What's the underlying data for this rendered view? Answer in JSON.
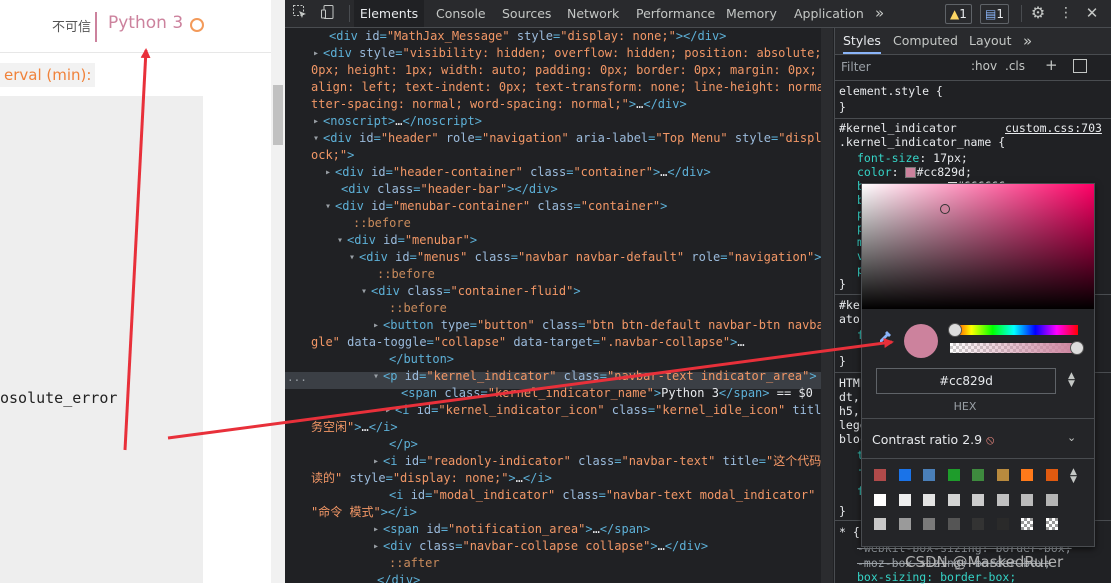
{
  "page": {
    "not_trusted": "不可信",
    "kernel_name": "Python 3",
    "interval_label": "erval (min):",
    "code_text": "osolute_error"
  },
  "devtools": {
    "tabs": [
      "Elements",
      "Console",
      "Sources",
      "Network",
      "Performance",
      "Memory",
      "Application"
    ],
    "more_tabs": "»",
    "warn_count": "1",
    "info_count": "1",
    "icons": [
      "inspect-icon",
      "device-toggle-icon",
      "gear-icon",
      "kebab-menu-icon",
      "close-icon"
    ]
  },
  "elements": {
    "lines": [
      {
        "indent": 3,
        "tri": "",
        "parts": [
          [
            "tag",
            "<div "
          ],
          [
            "an",
            "id"
          ],
          [
            "tag",
            "="
          ],
          [
            "av",
            "\"MathJax_Message\""
          ],
          [
            "an",
            " style"
          ],
          [
            "tag",
            "="
          ],
          [
            "av",
            "\"display: none;\""
          ],
          [
            "tag",
            "></div>"
          ]
        ]
      },
      {
        "indent": 2,
        "tri": "▸",
        "parts": [
          [
            "tag",
            "<div "
          ],
          [
            "an",
            "style"
          ],
          [
            "tag",
            "="
          ],
          [
            "av",
            "\"visibility: hidden; overflow: hidden; position: absolute; top:"
          ]
        ]
      },
      {
        "indent": 0,
        "tri": "",
        "parts": [
          [
            "av",
            "0px; height: 1px; width: auto; padding: 0px; border: 0px; margin: 0px; text-"
          ]
        ]
      },
      {
        "indent": 0,
        "tri": "",
        "parts": [
          [
            "av",
            "align: left; text-indent: 0px; text-transform: none; line-height: normal; le"
          ]
        ]
      },
      {
        "indent": 0,
        "tri": "",
        "parts": [
          [
            "av",
            "tter-spacing: normal; word-spacing: normal;\""
          ],
          [
            "tag",
            ">"
          ],
          [
            "txt",
            "…"
          ],
          [
            "tag",
            "</div>"
          ]
        ]
      },
      {
        "indent": 2,
        "tri": "▸",
        "parts": [
          [
            "tag",
            "<noscript>"
          ],
          [
            "txt",
            "…"
          ],
          [
            "tag",
            "</noscript>"
          ]
        ]
      },
      {
        "indent": 2,
        "tri": "▾",
        "parts": [
          [
            "tag",
            "<div "
          ],
          [
            "an",
            "id"
          ],
          [
            "tag",
            "="
          ],
          [
            "av",
            "\"header\""
          ],
          [
            "an",
            " role"
          ],
          [
            "tag",
            "="
          ],
          [
            "av",
            "\"navigation\""
          ],
          [
            "an",
            " aria-label"
          ],
          [
            "tag",
            "="
          ],
          [
            "av",
            "\"Top Menu\""
          ],
          [
            "an",
            " style"
          ],
          [
            "tag",
            "="
          ],
          [
            "av",
            "\"display: bl"
          ]
        ]
      },
      {
        "indent": 0,
        "tri": "",
        "parts": [
          [
            "av",
            "ock;\""
          ],
          [
            "tag",
            ">"
          ]
        ]
      },
      {
        "indent": 4,
        "tri": "▸",
        "parts": [
          [
            "tag",
            "<div "
          ],
          [
            "an",
            "id"
          ],
          [
            "tag",
            "="
          ],
          [
            "av",
            "\"header-container\""
          ],
          [
            "an",
            " class"
          ],
          [
            "tag",
            "="
          ],
          [
            "av",
            "\"container\""
          ],
          [
            "tag",
            ">"
          ],
          [
            "txt",
            "…"
          ],
          [
            "tag",
            "</div>"
          ]
        ]
      },
      {
        "indent": 5,
        "tri": "",
        "parts": [
          [
            "tag",
            "<div "
          ],
          [
            "an",
            "class"
          ],
          [
            "tag",
            "="
          ],
          [
            "av",
            "\"header-bar\""
          ],
          [
            "tag",
            "></div>"
          ]
        ]
      },
      {
        "indent": 4,
        "tri": "▾",
        "parts": [
          [
            "tag",
            "<div "
          ],
          [
            "an",
            "id"
          ],
          [
            "tag",
            "="
          ],
          [
            "av",
            "\"menubar-container\""
          ],
          [
            "an",
            " class"
          ],
          [
            "tag",
            "="
          ],
          [
            "av",
            "\"container\""
          ],
          [
            "tag",
            ">"
          ]
        ]
      },
      {
        "indent": 7,
        "tri": "",
        "parts": [
          [
            "pseudo",
            "::before"
          ]
        ]
      },
      {
        "indent": 6,
        "tri": "▾",
        "parts": [
          [
            "tag",
            "<div "
          ],
          [
            "an",
            "id"
          ],
          [
            "tag",
            "="
          ],
          [
            "av",
            "\"menubar\""
          ],
          [
            "tag",
            ">"
          ]
        ]
      },
      {
        "indent": 8,
        "tri": "▾",
        "parts": [
          [
            "tag",
            "<div "
          ],
          [
            "an",
            "id"
          ],
          [
            "tag",
            "="
          ],
          [
            "av",
            "\"menus\""
          ],
          [
            "an",
            " class"
          ],
          [
            "tag",
            "="
          ],
          [
            "av",
            "\"navbar navbar-default\""
          ],
          [
            "an",
            " role"
          ],
          [
            "tag",
            "="
          ],
          [
            "av",
            "\"navigation\""
          ],
          [
            "tag",
            ">"
          ]
        ]
      },
      {
        "indent": 11,
        "tri": "",
        "parts": [
          [
            "pseudo",
            "::before"
          ]
        ]
      },
      {
        "indent": 10,
        "tri": "▾",
        "parts": [
          [
            "tag",
            "<div "
          ],
          [
            "an",
            "class"
          ],
          [
            "tag",
            "="
          ],
          [
            "av",
            "\"container-fluid\""
          ],
          [
            "tag",
            ">"
          ]
        ]
      },
      {
        "indent": 13,
        "tri": "",
        "parts": [
          [
            "pseudo",
            "::before"
          ]
        ]
      },
      {
        "indent": 12,
        "tri": "▸",
        "parts": [
          [
            "tag",
            "<button "
          ],
          [
            "an",
            "type"
          ],
          [
            "tag",
            "="
          ],
          [
            "av",
            "\"button\""
          ],
          [
            "an",
            " class"
          ],
          [
            "tag",
            "="
          ],
          [
            "av",
            "\"btn btn-default navbar-btn navbar-tog"
          ]
        ]
      },
      {
        "indent": 0,
        "tri": "",
        "parts": [
          [
            "av",
            "gle\""
          ],
          [
            "an",
            " data-toggle"
          ],
          [
            "tag",
            "="
          ],
          [
            "av",
            "\"collapse\""
          ],
          [
            "an",
            " data-target"
          ],
          [
            "tag",
            "="
          ],
          [
            "av",
            "\".navbar-collapse\""
          ],
          [
            "tag",
            ">"
          ],
          [
            "txt",
            "…"
          ]
        ]
      },
      {
        "indent": 13,
        "tri": "",
        "parts": [
          [
            "tag",
            "</button>"
          ]
        ]
      },
      {
        "indent": 12,
        "tri": "▾",
        "parts": [
          [
            "tag",
            "<p "
          ],
          [
            "an",
            "id"
          ],
          [
            "tag",
            "="
          ],
          [
            "av",
            "\"kernel_indicator\""
          ],
          [
            "an",
            " class"
          ],
          [
            "tag",
            "="
          ],
          [
            "av",
            "\"navbar-text indicator_area\""
          ],
          [
            "tag",
            ">"
          ]
        ]
      },
      {
        "indent": 15,
        "tri": "",
        "parts": [
          [
            "tag",
            "<span "
          ],
          [
            "an",
            "class"
          ],
          [
            "tag",
            "="
          ],
          [
            "av",
            "\"kernel_indicator_name\""
          ],
          [
            "tag",
            ">"
          ],
          [
            "txt",
            "Python 3"
          ],
          [
            "tag",
            "</span>"
          ],
          [
            "txt",
            " == $0"
          ]
        ]
      },
      {
        "indent": 14,
        "tri": "▸",
        "parts": [
          [
            "tag",
            "<i "
          ],
          [
            "an",
            "id"
          ],
          [
            "tag",
            "="
          ],
          [
            "av",
            "\"kernel_indicator_icon\""
          ],
          [
            "an",
            " class"
          ],
          [
            "tag",
            "="
          ],
          [
            "av",
            "\"kernel_idle_icon\""
          ],
          [
            "an",
            " title"
          ],
          [
            "tag",
            "="
          ],
          [
            "av",
            "\"服"
          ]
        ]
      },
      {
        "indent": 0,
        "tri": "",
        "parts": [
          [
            "av",
            "务空闲\""
          ],
          [
            "tag",
            ">"
          ],
          [
            "txt",
            "…"
          ],
          [
            "tag",
            "</i>"
          ]
        ]
      },
      {
        "indent": 13,
        "tri": "",
        "parts": [
          [
            "tag",
            "</p>"
          ]
        ]
      },
      {
        "indent": 12,
        "tri": "▸",
        "parts": [
          [
            "tag",
            "<i "
          ],
          [
            "an",
            "id"
          ],
          [
            "tag",
            "="
          ],
          [
            "av",
            "\"readonly-indicator\""
          ],
          [
            "an",
            " class"
          ],
          [
            "tag",
            "="
          ],
          [
            "av",
            "\"navbar-text\""
          ],
          [
            "an",
            " title"
          ],
          [
            "tag",
            "="
          ],
          [
            "av",
            "\"这个代码是只"
          ]
        ]
      },
      {
        "indent": 0,
        "tri": "",
        "parts": [
          [
            "av",
            "读的\""
          ],
          [
            "an",
            " style"
          ],
          [
            "tag",
            "="
          ],
          [
            "av",
            "\"display: none;\""
          ],
          [
            "tag",
            ">"
          ],
          [
            "txt",
            "…"
          ],
          [
            "tag",
            "</i>"
          ]
        ]
      },
      {
        "indent": 13,
        "tri": "",
        "parts": [
          [
            "tag",
            "<i "
          ],
          [
            "an",
            "id"
          ],
          [
            "tag",
            "="
          ],
          [
            "av",
            "\"modal_indicator\""
          ],
          [
            "an",
            " class"
          ],
          [
            "tag",
            "="
          ],
          [
            "av",
            "\"navbar-text modal_indicator\""
          ],
          [
            "an",
            " title"
          ],
          [
            "tag",
            "="
          ]
        ]
      },
      {
        "indent": 0,
        "tri": "",
        "parts": [
          [
            "av",
            "\"命令 模式\""
          ],
          [
            "tag",
            "></i>"
          ]
        ]
      },
      {
        "indent": 12,
        "tri": "▸",
        "parts": [
          [
            "tag",
            "<span "
          ],
          [
            "an",
            "id"
          ],
          [
            "tag",
            "="
          ],
          [
            "av",
            "\"notification_area\""
          ],
          [
            "tag",
            ">"
          ],
          [
            "txt",
            "…"
          ],
          [
            "tag",
            "</span>"
          ]
        ]
      },
      {
        "indent": 12,
        "tri": "▸",
        "parts": [
          [
            "tag",
            "<div "
          ],
          [
            "an",
            "class"
          ],
          [
            "tag",
            "="
          ],
          [
            "av",
            "\"navbar-collapse collapse\""
          ],
          [
            "tag",
            ">"
          ],
          [
            "txt",
            "…"
          ],
          [
            "tag",
            "</div>"
          ]
        ]
      },
      {
        "indent": 13,
        "tri": "",
        "parts": [
          [
            "pseudo",
            "::after"
          ]
        ]
      },
      {
        "indent": 11,
        "tri": "",
        "parts": [
          [
            "tag",
            "</div>"
          ]
        ]
      },
      {
        "indent": 11,
        "tri": "",
        "parts": [
          [
            "pseudo",
            "::after"
          ]
        ]
      }
    ],
    "selected_marker": "···"
  },
  "styles": {
    "tabs": [
      "Styles",
      "Computed",
      "Layout",
      "»"
    ],
    "filter_placeholder": "Filter",
    "hov": ":hov",
    "cls": ".cls",
    "element_style": "element.style {",
    "close_brace": "}",
    "rule_selector_1": "#kernel_indicator",
    "rule_selector_2": ".kernel_indicator_name {",
    "rule_source": "custom.css:703",
    "font_size_prop": "font-size",
    "font_size_val": "17px;",
    "color_prop": "color",
    "color_val": "#cc829d;",
    "bg_val": "#666666;",
    "rule2_a": "#ker",
    "rule2_b": "ator",
    "html_a": "HTML",
    "html_b": "dt,",
    "html_c": "h5,",
    "html_d": "lege",
    "html_e": "bloc",
    "star_rule": "* {",
    "webkit_box": "-webkit-box-sizing: border-box;",
    "moz_box": "-moz-box-sizing: border-box;",
    "box_sizing": "box-sizing: border-box;"
  },
  "picker": {
    "hex_value": "#cc829d",
    "hex_label": "HEX",
    "contrast_label": "Contrast ratio",
    "contrast_value": "2.9",
    "palette_row1": [
      "#b04a4a",
      "#1a73e8",
      "#4a7fb8",
      "#1e9c2b",
      "#3e8a3e",
      "#b88a3e",
      "#ff7a1a",
      "#e05a10"
    ],
    "palette_row2": [
      "#ffffff",
      "#eeeeee",
      "#e3e3e3",
      "#d4d4d4",
      "#cccccc",
      "#c0c0c0",
      "#bbbbbb",
      "#b5b5b5"
    ],
    "palette_row3": [
      "#c8c8c8",
      "#9a9a9a",
      "#7a7a7a",
      "#555555",
      "#333333",
      "#2a2a2a",
      "checker",
      "checker"
    ]
  },
  "colors": {
    "kernel": "#cc829d",
    "arrow": "#e8303a"
  },
  "watermark": "CSDN @MaskedRuler"
}
